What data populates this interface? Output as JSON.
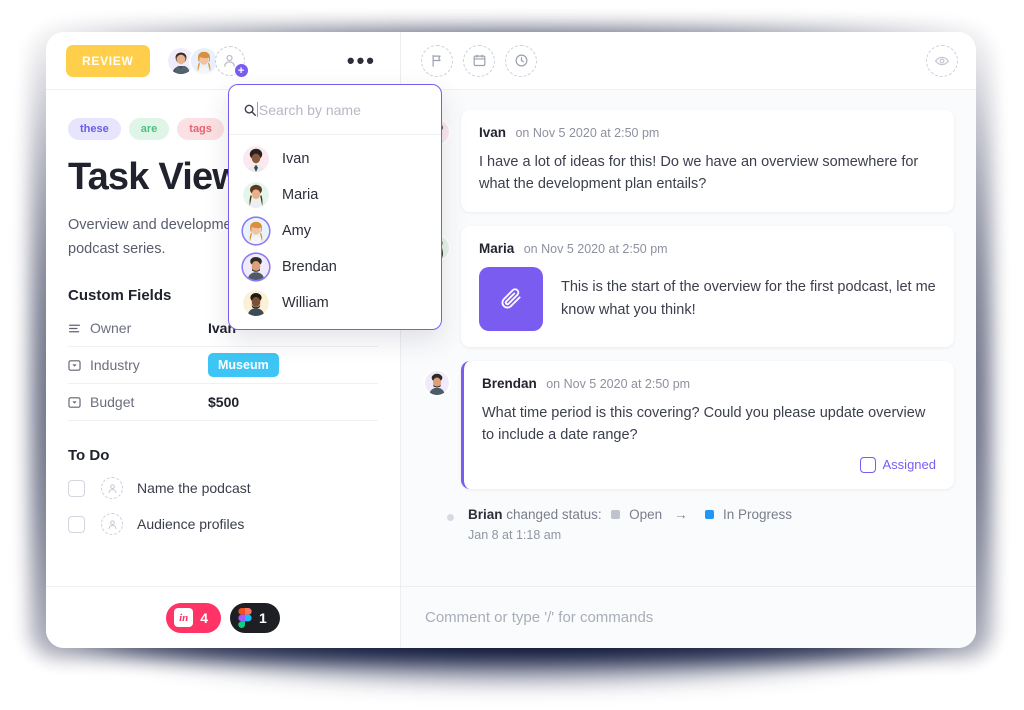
{
  "header": {
    "status_button": "REVIEW",
    "members": [
      {
        "name": "member-1"
      },
      {
        "name": "member-2"
      }
    ],
    "add_member_icon": "add-person-icon",
    "more_menu": "•••",
    "right_icons": [
      "flag-icon",
      "calendar-icon",
      "clock-icon"
    ],
    "watch_icon": "eye-icon"
  },
  "assignee_dropdown": {
    "search_placeholder": "Search by name",
    "search_value": "",
    "search_icon": "search-icon",
    "people": [
      {
        "name": "Ivan",
        "selected": false
      },
      {
        "name": "Maria",
        "selected": false
      },
      {
        "name": "Amy",
        "selected": true
      },
      {
        "name": "Brendan",
        "selected": true
      },
      {
        "name": "William",
        "selected": false
      }
    ]
  },
  "task": {
    "tags": [
      {
        "label": "these",
        "color": "#6c5ce7"
      },
      {
        "label": "are",
        "color": "#4ec07e"
      },
      {
        "label": "tags",
        "color": "#e8636f"
      }
    ],
    "title": "Task View",
    "description": "Overview and development plan for original podcast series.",
    "custom_fields_title": "Custom Fields",
    "custom_fields": [
      {
        "icon": "list-icon",
        "label": "Owner",
        "value": "Ivan",
        "type": "text"
      },
      {
        "icon": "dropdown-icon",
        "label": "Industry",
        "value": "Museum",
        "type": "badge",
        "badge_color": "#3dc6f5"
      },
      {
        "icon": "dropdown-icon",
        "label": "Budget",
        "value": "$500",
        "type": "text"
      }
    ],
    "todo_title": "To Do",
    "todos": [
      {
        "label": "Name the podcast",
        "done": false
      },
      {
        "label": "Audience profiles",
        "done": false
      }
    ]
  },
  "thread": {
    "comments": [
      {
        "author": "Ivan",
        "time": "on Nov 5 2020 at 2:50 pm",
        "text": "I have a lot of ideas for this! Do we have an overview somewhere for what the development plan entails?",
        "has_attachment": false,
        "assigned": false
      },
      {
        "author": "Maria",
        "time": "on Nov 5 2020 at 2:50 pm",
        "text": "This is the start of the overview for the first podcast, let me know what you think!",
        "has_attachment": true,
        "attachment_icon": "paperclip-icon",
        "assigned": false
      },
      {
        "author": "Brendan",
        "time": "on Nov 5 2020 at 2:50 pm",
        "text": "What time period is this covering? Could you please update overview to include a date range?",
        "has_attachment": false,
        "assigned": true,
        "assigned_label": "Assigned"
      }
    ],
    "activity": {
      "actor": "Brian",
      "action": "changed status:",
      "from_status": "Open",
      "from_color": "#bfc4cc",
      "arrow": "→",
      "to_status": "In Progress",
      "to_color": "#2196f3",
      "time": "Jan 8 at 1:18 am"
    }
  },
  "footer": {
    "integrations": [
      {
        "name": "invision",
        "label": "in",
        "count": "4",
        "color": "#ff3366"
      },
      {
        "name": "figma",
        "label": "figma-icon",
        "count": "1",
        "color": "#1d1f24"
      }
    ],
    "comment_placeholder": "Comment or type '/' for commands",
    "comment_value": ""
  }
}
